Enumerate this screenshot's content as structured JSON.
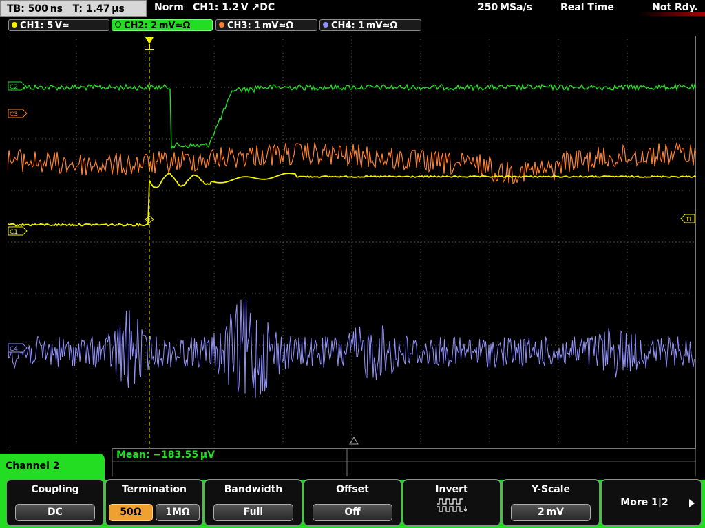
{
  "status_bar": {
    "timebase": "TB: 500 ns",
    "trigger_time": "T: 1.47 µs",
    "trigger_mode": "Norm",
    "trigger_info": "CH1: 1.2 V ↗DC",
    "sample_rate": "250 MSa/s",
    "acq_mode": "Real Time",
    "status": "Not Rdy."
  },
  "channels": [
    {
      "label": "CH1: 5 V≃",
      "color": "#f5f500"
    },
    {
      "label": "CH2: 2 mV≃Ω",
      "color": "#22dd22"
    },
    {
      "label": "CH3: 1 mV≃Ω",
      "color": "#ff8030"
    },
    {
      "label": "CH4: 1 mV≃Ω",
      "color": "#9090ff"
    }
  ],
  "markers": {
    "c1": "C1",
    "c2": "C2",
    "c3": "C3",
    "c4": "C4",
    "trigger_level": "TL"
  },
  "measurement": {
    "mean": "Mean: −183.55 µV"
  },
  "menu": {
    "title": "Channel 2",
    "softkeys": [
      {
        "label": "Coupling",
        "value": "DC"
      },
      {
        "label": "Termination",
        "options": [
          "50Ω",
          "1MΩ"
        ],
        "selected": "50Ω"
      },
      {
        "label": "Bandwidth",
        "value": "Full"
      },
      {
        "label": "Offset",
        "value": "Off"
      },
      {
        "label": "Invert",
        "icon": "invert-wave-icon"
      },
      {
        "label": "Y-Scale",
        "value": "2 mV"
      },
      {
        "label": "More 1|2",
        "icon": "arrow-right-icon"
      }
    ]
  },
  "colors": {
    "ch1": "#f5f500",
    "ch2": "#22dd22",
    "ch3": "#ff8030",
    "ch4": "#9090ff",
    "grid": "#5a5a5a",
    "softkey_selected": "#f0a030"
  }
}
